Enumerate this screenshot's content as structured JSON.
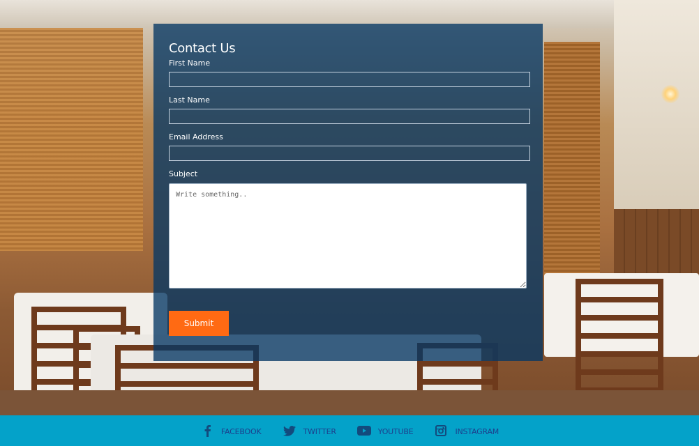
{
  "contact": {
    "title": "Contact Us",
    "first_name_label": "First Name",
    "first_name_value": "",
    "last_name_label": "Last Name",
    "last_name_value": "",
    "email_label": "Email Address",
    "email_value": "",
    "subject_label": "Subject",
    "subject_placeholder": "Write something..",
    "submit_label": "Submit"
  },
  "footer": {
    "links": [
      {
        "label": "FACEBOOK",
        "icon": "facebook-icon"
      },
      {
        "label": "TWITTER",
        "icon": "twitter-icon"
      },
      {
        "label": "YOUTUBE",
        "icon": "youtube-icon"
      },
      {
        "label": "INSTAGRAM",
        "icon": "instagram-icon"
      }
    ]
  },
  "colors": {
    "panel": "#05376 4",
    "submit": "#ff6a13",
    "footer": "#04a2c9",
    "footer_text": "#1d3f8c"
  }
}
